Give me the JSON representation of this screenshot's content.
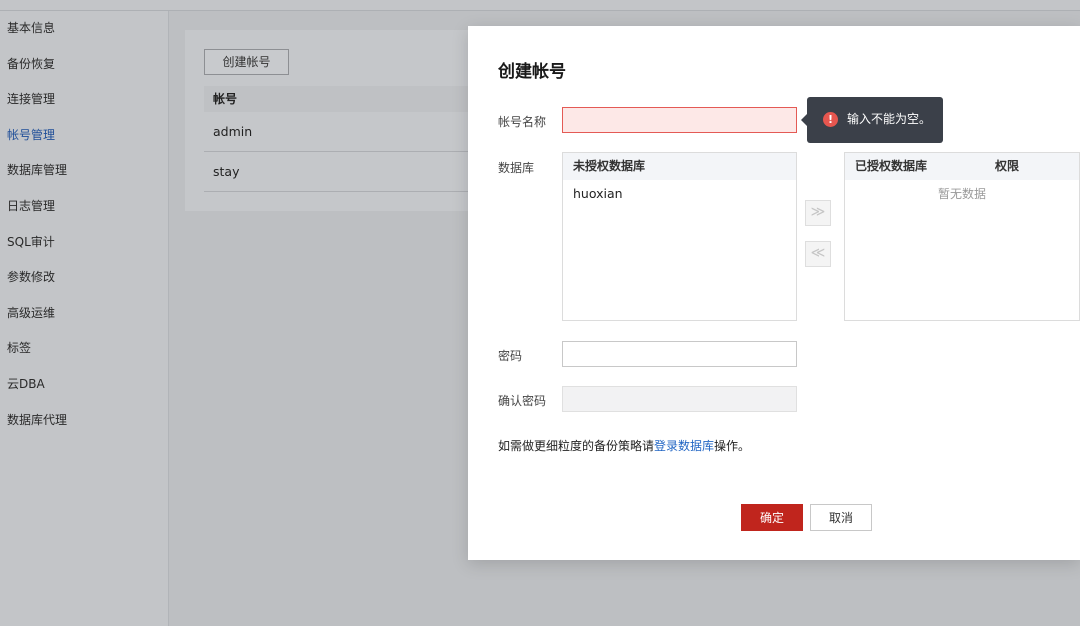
{
  "sidebar": {
    "items": [
      {
        "label": "基本信息"
      },
      {
        "label": "备份恢复"
      },
      {
        "label": "连接管理"
      },
      {
        "label": "帐号管理"
      },
      {
        "label": "数据库管理"
      },
      {
        "label": "日志管理"
      },
      {
        "label": "SQL审计"
      },
      {
        "label": "参数修改"
      },
      {
        "label": "高级运维"
      },
      {
        "label": "标签"
      },
      {
        "label": "云DBA"
      },
      {
        "label": "数据库代理"
      }
    ],
    "active_index": 3
  },
  "background": {
    "create_button": "创建帐号",
    "table": {
      "header": "帐号",
      "rows": [
        "admin",
        "stay"
      ]
    }
  },
  "dialog": {
    "title": "创建帐号",
    "account_name": {
      "label": "帐号名称",
      "value": ""
    },
    "tooltip": "输入不能为空。",
    "database": {
      "label": "数据库",
      "unauthorized_title": "未授权数据库",
      "unauthorized_items": [
        "huoxian"
      ],
      "authorized_title": "已授权数据库",
      "permission_title": "权限",
      "authorized_empty": "暂无数据",
      "move_right": "≫",
      "move_left": "≪"
    },
    "password": {
      "label": "密码",
      "value": ""
    },
    "confirm_password": {
      "label": "确认密码",
      "value": ""
    },
    "hint_prefix": "如需做更细粒度的备份策略请",
    "hint_link": "登录数据库",
    "hint_suffix": "操作。",
    "ok_label": "确定",
    "cancel_label": "取消"
  }
}
